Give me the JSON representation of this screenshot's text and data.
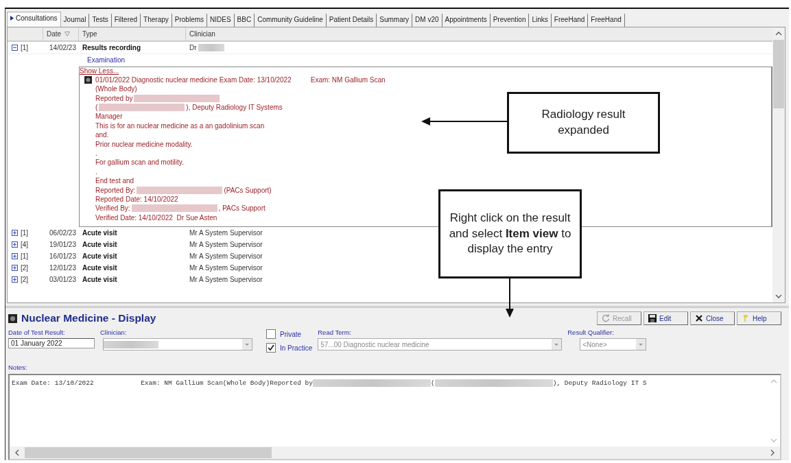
{
  "tabs": [
    {
      "label": "Consultations",
      "selected": true
    },
    {
      "label": "Journal",
      "selected": false
    },
    {
      "label": "Tests",
      "selected": false
    },
    {
      "label": "Filtered",
      "selected": false
    },
    {
      "label": "Therapy",
      "selected": false
    },
    {
      "label": "Problems",
      "selected": false
    },
    {
      "label": "NIDES",
      "selected": false
    },
    {
      "label": "BBC",
      "selected": false
    },
    {
      "label": "Community Guideline",
      "selected": false
    },
    {
      "label": "Patient Details",
      "selected": false
    },
    {
      "label": "Summary",
      "selected": false
    },
    {
      "label": "DM v20",
      "selected": false
    },
    {
      "label": "Appointments",
      "selected": false
    },
    {
      "label": "Prevention",
      "selected": false
    },
    {
      "label": "Links",
      "selected": false
    },
    {
      "label": "FreeHand",
      "selected": false
    },
    {
      "label": "FreeHand",
      "selected": false
    }
  ],
  "columns": [
    "Date",
    "Type",
    "Clinician"
  ],
  "records": [
    {
      "expanded": true,
      "count": "[1]",
      "date": "14/02/23",
      "type": "Results recording",
      "clinician": "Dr",
      "clinician_redacted": true,
      "detail": {
        "section": "Examination",
        "toggle": "Show Less...",
        "lines": [
          [
            {
              "kind": "text",
              "text": "01/01/2022 Diagnostic nuclear medicine Exam Date: 13/10/2022"
            },
            {
              "kind": "tabbed",
              "text": "Exam: NM Gallium Scan"
            }
          ],
          [
            {
              "kind": "text",
              "text": "(Whole Body)"
            }
          ],
          [
            {
              "kind": "text",
              "text": "Reported by"
            },
            {
              "kind": "redacted"
            }
          ],
          [
            {
              "kind": "text",
              "text": "("
            },
            {
              "kind": "redacted"
            },
            {
              "kind": "text",
              "text": "), Deputy Radiology IT Systems"
            }
          ],
          [
            {
              "kind": "text",
              "text": "Manager"
            }
          ],
          [
            {
              "kind": "text",
              "text": "This is for an nuclear medicine as a an gadolinium scan"
            }
          ],
          [
            {
              "kind": "text",
              "text": "and."
            }
          ],
          [
            {
              "kind": "text",
              "text": "Prior nuclear medicine modality."
            }
          ],
          [
            {
              "kind": "text",
              "text": "."
            }
          ],
          [
            {
              "kind": "text",
              "text": "For gallium scan and motility."
            }
          ],
          [
            {
              "kind": "text",
              "text": "."
            }
          ],
          [
            {
              "kind": "text",
              "text": "End test and"
            }
          ],
          [
            {
              "kind": "text",
              "text": "Reported By:"
            },
            {
              "kind": "redacted"
            },
            {
              "kind": "text",
              "text": "(PACs Support)"
            }
          ],
          [
            {
              "kind": "text",
              "text": "Reported Date: 14/10/2022"
            }
          ],
          [
            {
              "kind": "text",
              "text": "Verified By:"
            },
            {
              "kind": "redacted"
            },
            {
              "kind": "text",
              "text": ", PACs Support"
            }
          ],
          [
            {
              "kind": "text",
              "text": "Verified Date: 14/10/2022  Dr Sue Asten"
            }
          ]
        ]
      }
    },
    {
      "expanded": false,
      "count": "[1]",
      "date": "06/02/23",
      "type": "Acute visit",
      "clinician": "Mr A System Supervisor",
      "clinician_redacted": false
    },
    {
      "expanded": false,
      "count": "[4]",
      "date": "19/01/23",
      "type": "Acute visit",
      "clinician": "Mr A System Supervisor",
      "clinician_redacted": false
    },
    {
      "expanded": false,
      "count": "[1]",
      "date": "16/01/23",
      "type": "Acute visit",
      "clinician": "Mr A System Supervisor",
      "clinician_redacted": false
    },
    {
      "expanded": false,
      "count": "[2]",
      "date": "12/01/23",
      "type": "Acute visit",
      "clinician": "Mr A System Supervisor",
      "clinician_redacted": false
    },
    {
      "expanded": false,
      "count": "[2]",
      "date": "03/01/23",
      "type": "Acute visit",
      "clinician": "Mr A System Supervisor",
      "clinician_redacted": false
    }
  ],
  "display": {
    "title": "Nuclear Medicine - Display",
    "buttons": [
      {
        "kind": "recall",
        "label": "Recall",
        "disabled": true
      },
      {
        "kind": "edit",
        "label": "Edit",
        "disabled": false
      },
      {
        "kind": "close",
        "label": "Close",
        "disabled": false
      },
      {
        "kind": "help",
        "label": "Help",
        "disabled": false
      }
    ],
    "date_label": "Date of Test Result:",
    "date_value": "01 January 2022",
    "clinician_label": "Clinician:",
    "checkboxes": [
      {
        "label": "Private",
        "checked": false
      },
      {
        "label": "In Practice",
        "checked": true
      }
    ],
    "read_term_label": "Read Term:",
    "read_term_value": "57...00 Diagnostic nuclear medicine",
    "qualifier_label": "Result Qualifier:",
    "qualifier_value": "<None>",
    "notes_label": "Notes:",
    "notes": [
      {
        "kind": "text",
        "text": "Exam Date: 13/10/2022            Exam: NM Gallium Scan(Whole Body)Reported by"
      },
      {
        "kind": "redacted"
      },
      {
        "kind": "text",
        "text": "("
      },
      {
        "kind": "redacted"
      },
      {
        "kind": "text",
        "text": "), Deputy Radiology IT S"
      }
    ]
  },
  "callouts": [
    {
      "text": "Radiology result expanded"
    },
    {
      "text": "Right click on the result and select **Item view** to display the entry"
    }
  ]
}
